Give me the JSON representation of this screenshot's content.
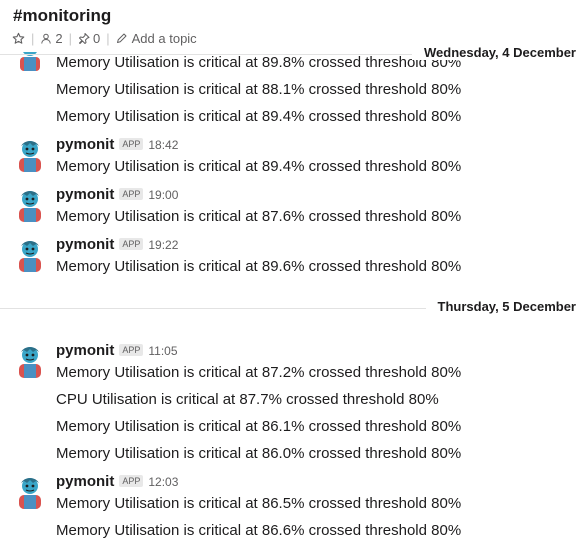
{
  "channel": {
    "name": "#monitoring",
    "members_count": "2",
    "pinned_count": "0",
    "add_topic_label": "Add a topic"
  },
  "dates": [
    "Wednesday, 4 December",
    "Thursday, 5 December"
  ],
  "messages": {
    "top_continuation": [
      "Memory Utilisation is critical at 89.8% crossed threshold 80%",
      "Memory Utilisation is critical at 88.1% crossed threshold 80%",
      "Memory Utilisation is critical at 89.4% crossed threshold 80%"
    ],
    "groups": [
      {
        "sender": "pymonit",
        "badge": "APP",
        "time": "18:42",
        "lines": [
          "Memory Utilisation is critical at 89.4% crossed threshold 80%"
        ]
      },
      {
        "sender": "pymonit",
        "badge": "APP",
        "time": "19:00",
        "lines": [
          "Memory Utilisation is critical at 87.6% crossed threshold 80%"
        ]
      },
      {
        "sender": "pymonit",
        "badge": "APP",
        "time": "19:22",
        "lines": [
          "Memory Utilisation is critical at 89.6% crossed threshold 80%"
        ]
      },
      {
        "sender": "pymonit",
        "badge": "APP",
        "time": "11:05",
        "lines": [
          "Memory Utilisation is critical at 87.2% crossed threshold 80%",
          "CPU Utilisation is critical at 87.7% crossed  threshold 80%",
          "Memory Utilisation is critical at 86.1% crossed threshold 80%",
          "Memory Utilisation is critical at 86.0% crossed threshold 80%"
        ]
      },
      {
        "sender": "pymonit",
        "badge": "APP",
        "time": "12:03",
        "lines": [
          "Memory Utilisation is critical at 86.5% crossed threshold 80%",
          "Memory Utilisation is critical at 86.6% crossed threshold 80%"
        ]
      }
    ]
  },
  "icons": {
    "star": "star-icon",
    "members": "person-icon",
    "pins": "pin-icon",
    "topic": "pencil-icon",
    "avatar": "zombie-avatar"
  }
}
